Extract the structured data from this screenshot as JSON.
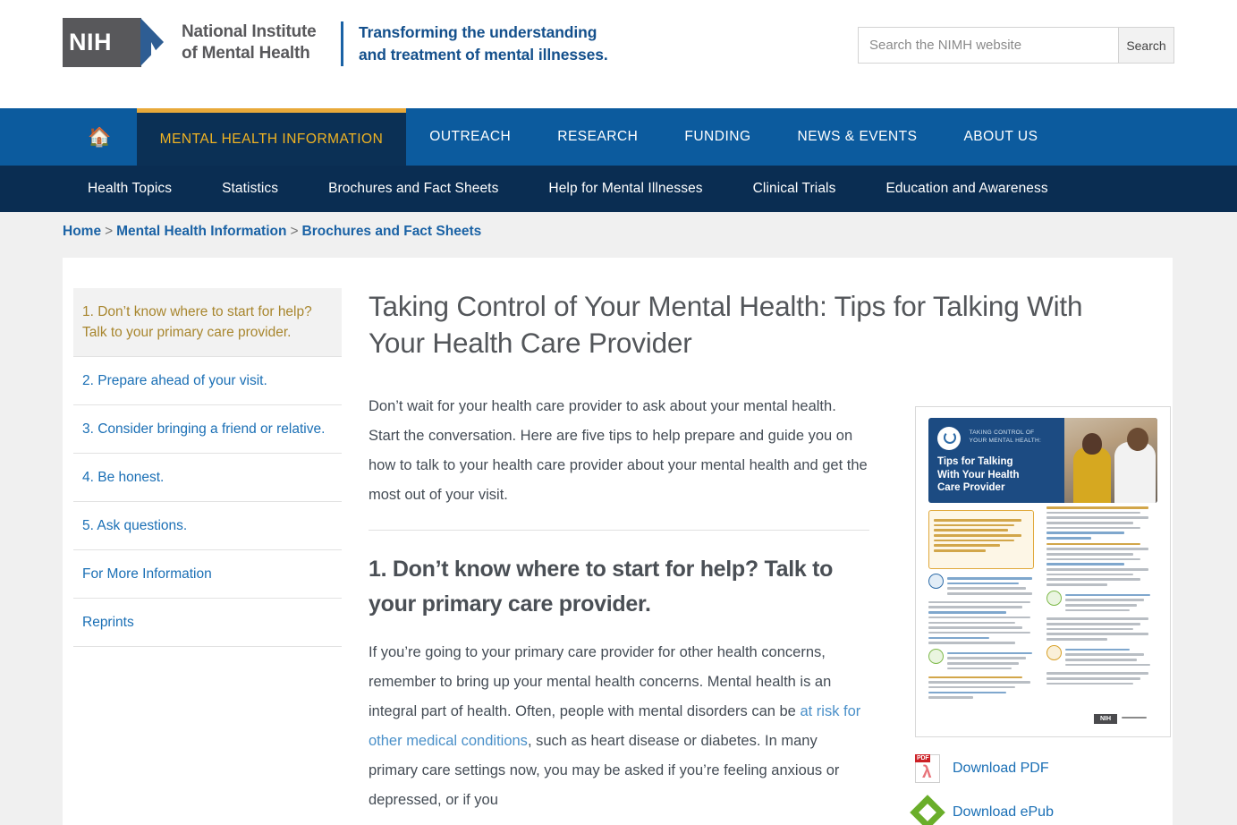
{
  "header": {
    "logo": {
      "mark_text": "NIH",
      "agency_line1": "National Institute",
      "agency_line2": "of Mental Health"
    },
    "tagline_line1": "Transforming the understanding",
    "tagline_line2": "and treatment of mental illnesses.",
    "search": {
      "placeholder": "Search the NIMH website",
      "value": "",
      "button_label": "Search"
    }
  },
  "nav_primary": {
    "home_label": "Home",
    "items": [
      {
        "label": "MENTAL HEALTH INFORMATION",
        "active": true
      },
      {
        "label": "OUTREACH",
        "active": false
      },
      {
        "label": "RESEARCH",
        "active": false
      },
      {
        "label": "FUNDING",
        "active": false
      },
      {
        "label": "NEWS & EVENTS",
        "active": false
      },
      {
        "label": "ABOUT US",
        "active": false
      }
    ]
  },
  "nav_secondary": {
    "items": [
      {
        "label": "Health Topics"
      },
      {
        "label": "Statistics"
      },
      {
        "label": "Brochures and Fact Sheets"
      },
      {
        "label": "Help for Mental Illnesses"
      },
      {
        "label": "Clinical Trials"
      },
      {
        "label": "Education and Awareness"
      }
    ]
  },
  "breadcrumb": {
    "item1": "Home",
    "sep1": ">",
    "item2": "Mental Health Information",
    "sep2": ">",
    "item3": "Brochures and Fact Sheets"
  },
  "sidebar": {
    "items": [
      {
        "label": "1. Don’t know where to start for help? Talk to your primary care provider.",
        "active": true
      },
      {
        "label": "2. Prepare ahead of your visit.",
        "active": false
      },
      {
        "label": "3. Consider bringing a friend or relative.",
        "active": false
      },
      {
        "label": "4. Be honest.",
        "active": false
      },
      {
        "label": "5. Ask questions.",
        "active": false
      },
      {
        "label": "For More Information",
        "active": false
      },
      {
        "label": "Reprints",
        "active": false
      }
    ]
  },
  "article": {
    "title": "Taking Control of Your Mental Health: Tips for Talking With Your Health Care Provider",
    "intro": "Don’t wait for your health care provider to ask about your mental health. Start the conversation. Here are five tips to help prepare and guide you on how to talk to your health care provider about your mental health and get the most out of your visit.",
    "section1_heading": "1. Don’t know where to start for help? Talk to your primary care provider.",
    "section1_text_part1": "If you’re going to your primary care provider for other health concerns, remember to bring up your mental health concerns. Mental health is an integral part of health. Often, people with mental disorders can be ",
    "section1_link": "at risk for other medical conditions",
    "section1_text_part2": ", such as heart disease or diabetes. In many primary care settings now, you may be asked if you’re feeling anxious or depressed, or if you"
  },
  "rail": {
    "thumbnail": {
      "kicker_line1": "TAKING CONTROL OF",
      "kicker_line2": "YOUR MENTAL HEALTH:",
      "title_line1": "Tips for Talking",
      "title_line2": "With Your Health",
      "title_line3": "Care Provider",
      "footer_mark": "NIH"
    },
    "download_pdf_label": "Download PDF",
    "download_epub_label": "Download ePub"
  },
  "colors": {
    "nav_primary_bg": "#0c5b9e",
    "nav_active_bg": "#0b3055",
    "nav_active_text": "#f0b323",
    "nav_active_border": "#e8a93a",
    "nav_secondary_bg": "#0a2d52",
    "link_blue": "#1a6fb5",
    "breadcrumb_blue": "#1a62a5",
    "body_text": "#444c55",
    "sidebar_active_text": "#a8862e",
    "page_bg": "#f0f0f0",
    "pdf_red": "#cc2026",
    "epub_green": "#6aae2a"
  }
}
